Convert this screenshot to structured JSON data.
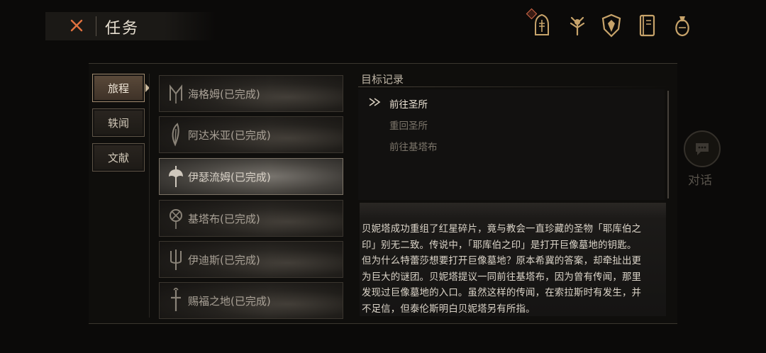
{
  "header": {
    "title": "任务"
  },
  "top_icons": [
    {
      "name": "character-icon",
      "has_notification": true
    },
    {
      "name": "skill-tree-icon"
    },
    {
      "name": "shield-icon"
    },
    {
      "name": "journal-icon"
    },
    {
      "name": "bag-icon"
    }
  ],
  "tabs": [
    {
      "label": "旅程",
      "active": true
    },
    {
      "label": "轶闻",
      "active": false
    },
    {
      "label": "文献",
      "active": false
    }
  ],
  "regions": [
    {
      "label": "海格姆(已完成)",
      "icon": "rune-m-icon"
    },
    {
      "label": "阿达米亚(已完成)",
      "icon": "feather-icon"
    },
    {
      "label": "伊瑟流姆(已完成)",
      "icon": "axe-icon",
      "selected": true
    },
    {
      "label": "基塔布(已完成)",
      "icon": "crest-icon"
    },
    {
      "label": "伊迪斯(已完成)",
      "icon": "trident-icon"
    },
    {
      "label": "赐福之地(已完成)",
      "icon": "sword-icon"
    }
  ],
  "objectives": {
    "header": "目标记录",
    "items": [
      {
        "text": "前往圣所",
        "status": "current"
      },
      {
        "text": "重回圣所",
        "status": "done"
      },
      {
        "text": "前往基塔布",
        "status": "done"
      }
    ]
  },
  "story": {
    "lines": [
      "贝妮塔成功重组了红星碎片，竟与教会一直珍藏的圣物「耶库伯之",
      "印」别无二致。传说中，「耶库伯之印」是打开巨像墓地的钥匙。",
      "但为什么特蕾莎想要打开巨像墓地？原本希冀的答案，却牵扯出更",
      "为巨大的谜团。贝妮塔提议一同前往基塔布，因为曾有传闻，那里",
      "发现过巨像墓地的入口。虽然这样的传闻，在索拉斯时有发生，并",
      "不足信，但泰伦斯明白贝妮塔另有所指。"
    ]
  },
  "dialogue": {
    "label": "对话"
  },
  "colors": {
    "accent": "#d46a4a",
    "icon_gold": "#c7a36a",
    "background": "#0b0a09"
  }
}
